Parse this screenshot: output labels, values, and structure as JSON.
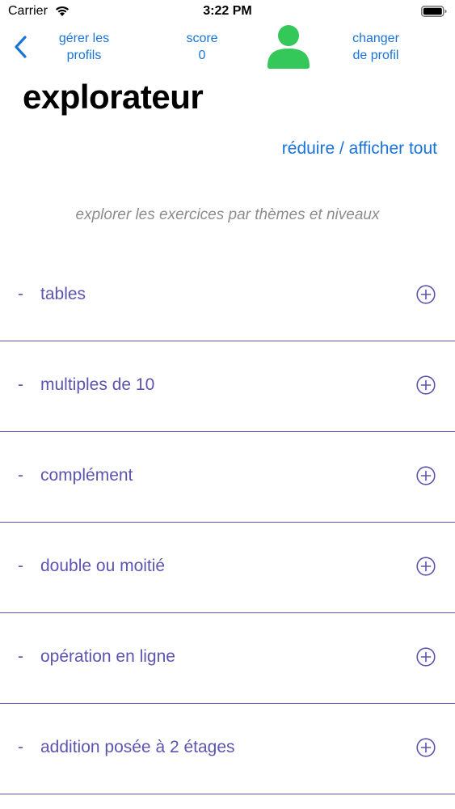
{
  "status_bar": {
    "carrier": "Carrier",
    "time": "3:22 PM"
  },
  "nav": {
    "manage_profiles": [
      "gérer les",
      "profils"
    ],
    "score_label": "score",
    "score_value": "0",
    "change_profile": [
      "changer",
      "de profil"
    ]
  },
  "page_title": "explorateur",
  "toggle_all_label": "réduire / afficher tout",
  "subtitle": "explorer les exercices par thèmes et niveaux",
  "themes": [
    {
      "dash": "-",
      "label": "tables"
    },
    {
      "dash": "-",
      "label": "multiples de 10"
    },
    {
      "dash": "-",
      "label": "complément"
    },
    {
      "dash": "-",
      "label": "double ou moitié"
    },
    {
      "dash": "-",
      "label": "opération en ligne"
    },
    {
      "dash": "-",
      "label": "addition posée à 2 étages"
    }
  ],
  "colors": {
    "accent_blue": "#1a73d9",
    "theme_purple": "#5b55b0",
    "avatar_green": "#34c759",
    "subtitle_gray": "#8c8c8c"
  },
  "icons": {
    "back": "chevron-left-icon",
    "avatar": "person-icon",
    "expand": "plus-circle-icon",
    "wifi": "wifi-icon",
    "battery": "battery-icon"
  }
}
